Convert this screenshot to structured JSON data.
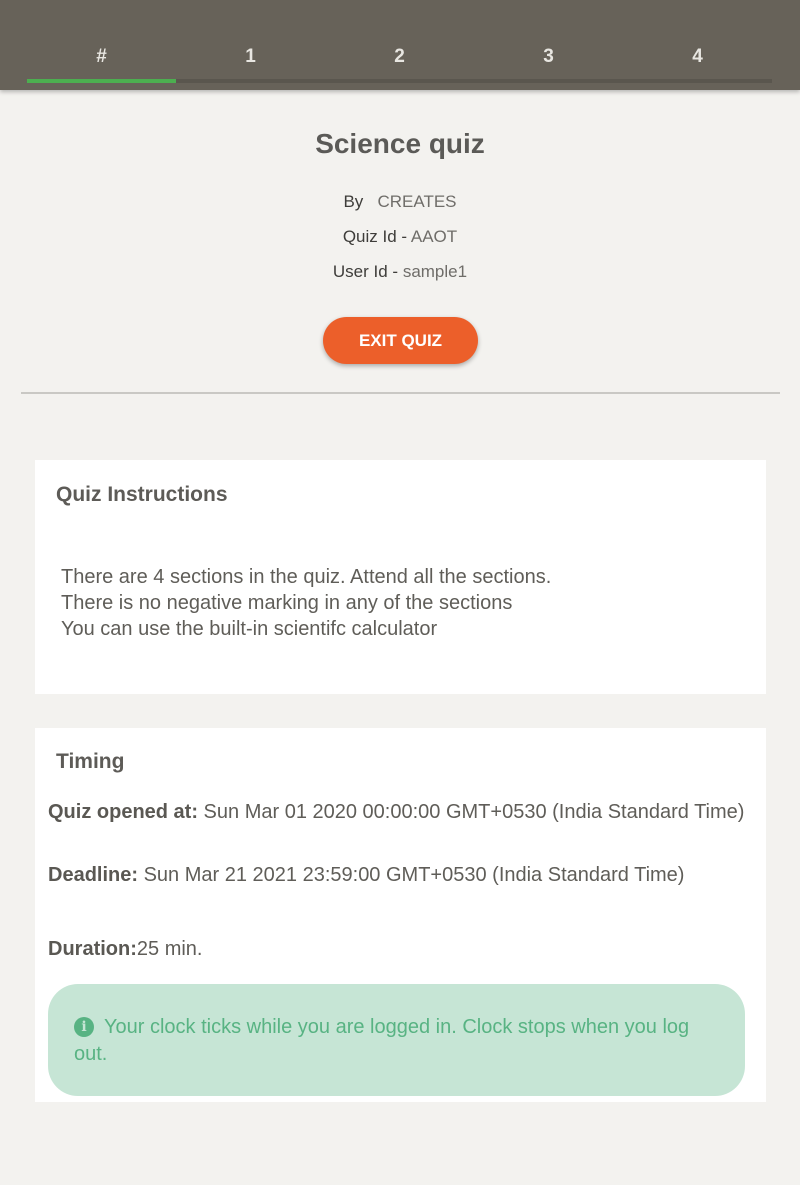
{
  "tabs": [
    "#",
    "1",
    "2",
    "3",
    "4"
  ],
  "header": {
    "title": "Science quiz",
    "by_label": "By",
    "by_value": "CREATES",
    "quiz_id_label": "Quiz Id - ",
    "quiz_id_value": "AAOT",
    "user_id_label": "User Id - ",
    "user_id_value": "sample1",
    "exit_label": "EXIT QUIZ"
  },
  "instructions": {
    "title": "Quiz Instructions",
    "lines": [
      "There are 4 sections in the quiz. Attend all the sections.",
      "There is no negative marking in any of the sections",
      "You can use the built-in scientifc calculator"
    ]
  },
  "timing": {
    "title": "Timing",
    "opened_label": "Quiz opened at:",
    "opened_value": " Sun Mar 01 2020 00:00:00 GMT+0530 (India Standard Time)",
    "deadline_label": "Deadline:",
    "deadline_value": " Sun Mar 21 2021 23:59:00 GMT+0530 (India Standard Time)",
    "duration_label": "Duration:",
    "duration_value": "25 min.",
    "alert_text": "Your clock ticks while you are logged in. Clock stops when you log out."
  },
  "colors": {
    "tabbar": "#676259",
    "accent_green": "#4caf50",
    "exit_button": "#ec5f2a",
    "alert_bg": "#c6e5d5",
    "alert_text": "#58b383"
  },
  "icons": {
    "alert": "info-icon"
  }
}
